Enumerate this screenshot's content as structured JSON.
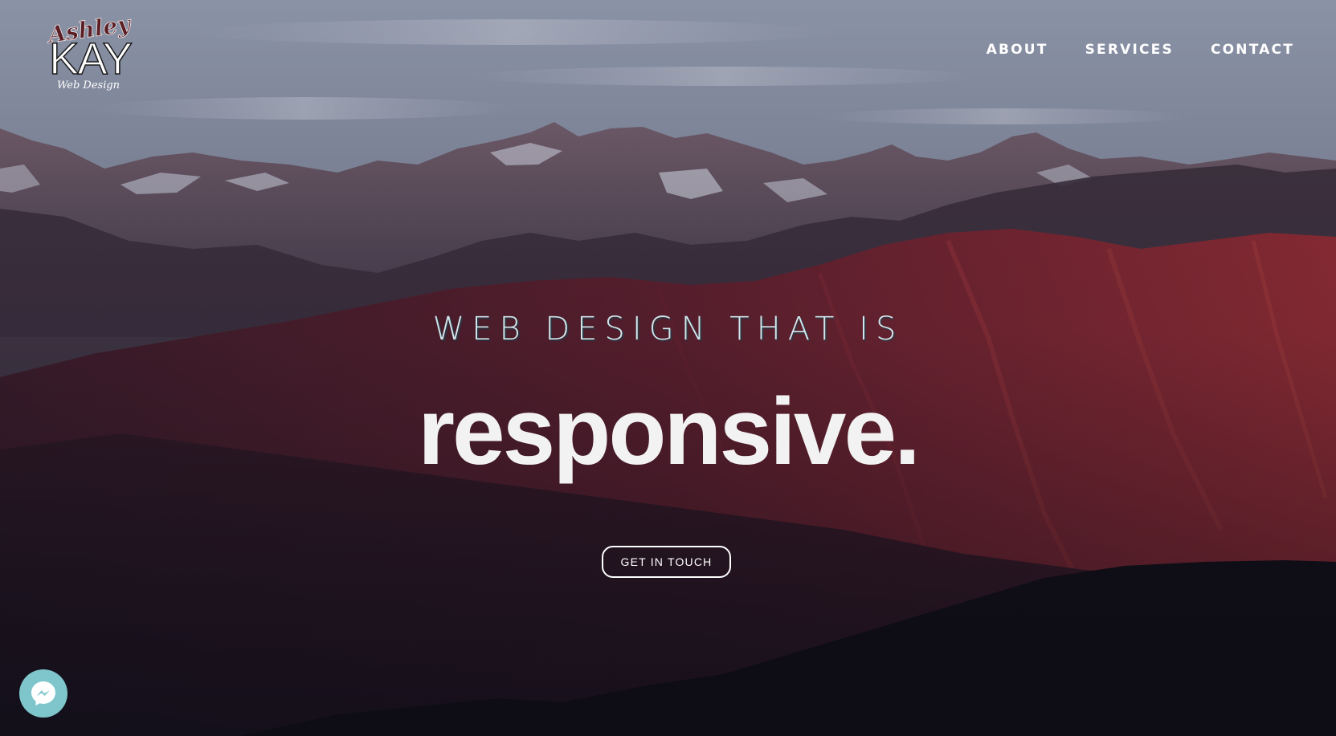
{
  "logo": {
    "script_text": "Ashley",
    "main_text": "KAY",
    "sub_text": "Web Design"
  },
  "nav": {
    "items": [
      {
        "label": "ABOUT"
      },
      {
        "label": "SERVICES"
      },
      {
        "label": "CONTACT"
      }
    ]
  },
  "hero": {
    "tagline": "WEB DESIGN THAT IS",
    "headline": "responsive.",
    "cta_label": "GET IN TOUCH",
    "background": "mountain-range-photo"
  },
  "widgets": {
    "messenger_icon": "messenger-icon"
  },
  "colors": {
    "tagline": "#cfe7ec",
    "headline": "#f2f2f2",
    "messenger_bg": "#7ec6cb"
  }
}
